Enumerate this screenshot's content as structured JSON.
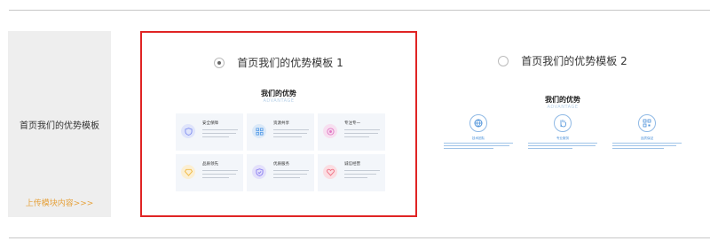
{
  "side": {
    "title": "首页我们的优势模板",
    "upload_link": "上传模块内容>>>"
  },
  "templates": [
    {
      "label": "首页我们的优势模板 1",
      "selected": true,
      "preview": {
        "title": "我们的优势",
        "subtitle": "ADVANTAGE",
        "items": [
          {
            "name": "安全保障",
            "icon": "shield-icon",
            "color": "#7f8ef0",
            "bg": "#dfe4fb"
          },
          {
            "name": "资源共享",
            "icon": "grid-icon",
            "color": "#5a9ee8",
            "bg": "#dbe9f8"
          },
          {
            "name": "专注专一",
            "icon": "target-icon",
            "color": "#e178c4",
            "bg": "#f7dff0"
          },
          {
            "name": "品质领先",
            "icon": "gem-icon",
            "color": "#f0b840",
            "bg": "#fbefd3"
          },
          {
            "name": "优质服务",
            "icon": "shield-check-icon",
            "color": "#8a7ef0",
            "bg": "#e3e0fb"
          },
          {
            "name": "诚信经营",
            "icon": "heart-icon",
            "color": "#ef6d80",
            "bg": "#fbdde2"
          }
        ]
      }
    },
    {
      "label": "首页我们的优势模板 2",
      "selected": false,
      "preview": {
        "title": "我们的优势",
        "subtitle": "ADVANTAGE",
        "items": [
          {
            "name": "技术团队",
            "icon": "globe-icon"
          },
          {
            "name": "专业服务",
            "icon": "hand-icon"
          },
          {
            "name": "品质保证",
            "icon": "qr-icon"
          }
        ]
      }
    }
  ]
}
